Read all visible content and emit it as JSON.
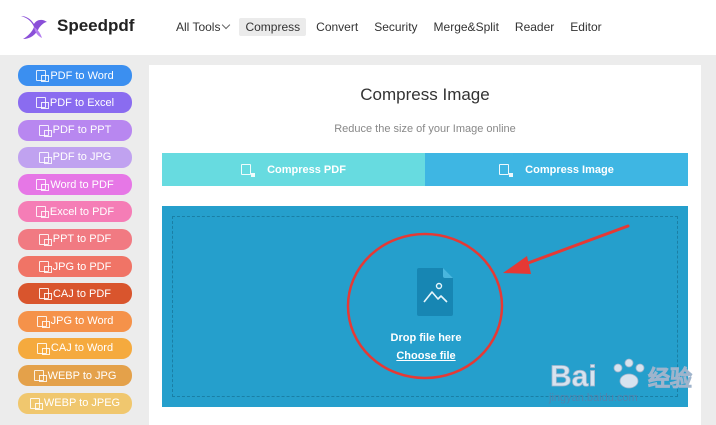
{
  "brand": {
    "name": "Speedpdf"
  },
  "nav": {
    "items": [
      {
        "label": "All Tools",
        "has_caret": true
      },
      {
        "label": "Compress",
        "active": true
      },
      {
        "label": "Convert"
      },
      {
        "label": "Security"
      },
      {
        "label": "Merge&Split"
      },
      {
        "label": "Reader"
      },
      {
        "label": "Editor"
      }
    ]
  },
  "sidebar": {
    "items": [
      {
        "label": "PDF to Word",
        "color": "#3b8ff0"
      },
      {
        "label": "PDF to Excel",
        "color": "#8a6cf0"
      },
      {
        "label": "PDF to PPT",
        "color": "#b887f0"
      },
      {
        "label": "PDF to JPG",
        "color": "#c0a2f0"
      },
      {
        "label": "Word to PDF",
        "color": "#e677e6"
      },
      {
        "label": "Excel to PDF",
        "color": "#f57db6"
      },
      {
        "label": "PPT to PDF",
        "color": "#f17a82"
      },
      {
        "label": "JPG to PDF",
        "color": "#f07466"
      },
      {
        "label": "CAJ to PDF",
        "color": "#d9552d"
      },
      {
        "label": "JPG to Word",
        "color": "#f5924a"
      },
      {
        "label": "CAJ to Word",
        "color": "#f5aa3e"
      },
      {
        "label": "WEBP to JPG",
        "color": "#e4a14a"
      },
      {
        "label": "WEBP to JPEG",
        "color": "#f0c76e"
      }
    ]
  },
  "main": {
    "title": "Compress Image",
    "subtitle": "Reduce the size of your Image online",
    "tabs": [
      {
        "label": "Compress PDF",
        "color": "#67dbe0"
      },
      {
        "label": "Compress Image",
        "color": "#3eb6e3",
        "active": true
      }
    ],
    "dropzone": {
      "text": "Drop file here",
      "choose_label": "Choose file",
      "color": "#259fcc"
    }
  },
  "annotation": {
    "color": "#e53935"
  },
  "watermark": {
    "brand": "Bai",
    "cn": "经验",
    "url": "jingyan.baidu.com"
  }
}
